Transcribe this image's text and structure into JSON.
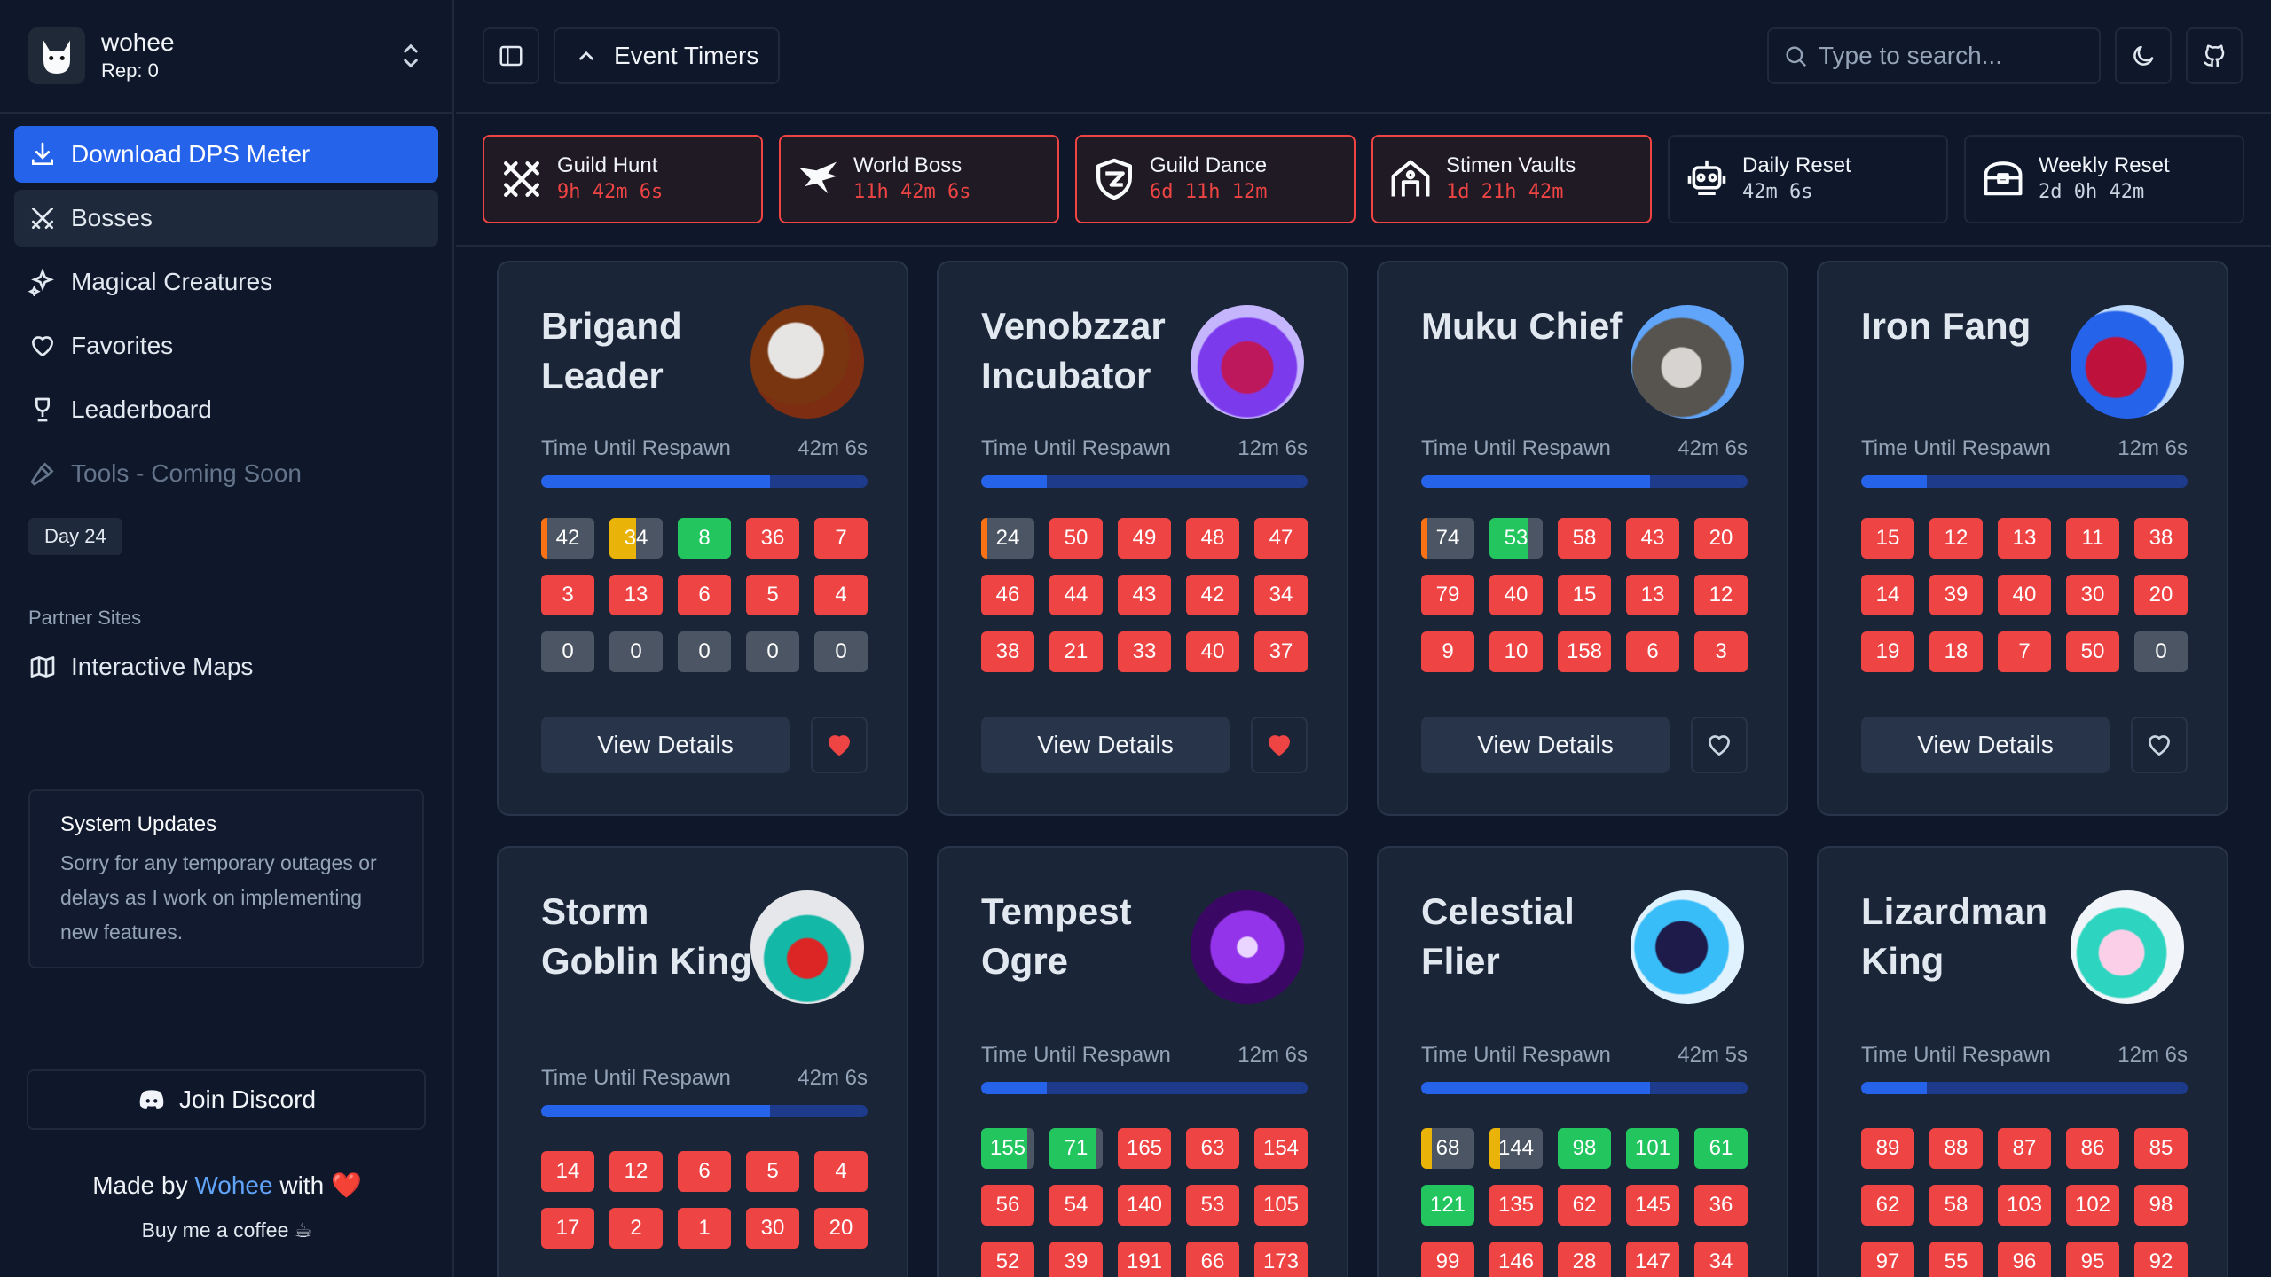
{
  "user": {
    "name": "wohee",
    "rep": "Rep: 0"
  },
  "nav": {
    "download": "Download DPS Meter",
    "bosses": "Bosses",
    "creatures": "Magical Creatures",
    "favorites": "Favorites",
    "leaderboard": "Leaderboard",
    "tools": "Tools - Coming Soon",
    "day": "Day 24",
    "partner_label": "Partner Sites",
    "maps": "Interactive Maps"
  },
  "updates": {
    "title": "System Updates",
    "body": "Sorry for any temporary outages or delays as I work on implementing new features."
  },
  "footer": {
    "discord": "Join Discord",
    "made_prefix": "Made by ",
    "made_name": "Wohee",
    "made_suffix": " with ",
    "heart": "❤️",
    "coffee": "Buy me a coffee ☕"
  },
  "topbar": {
    "event_timers": "Event Timers",
    "search_placeholder": "Type to search..."
  },
  "timers": [
    {
      "name": "Guild Hunt",
      "value": "9h 42m 6s",
      "state": "alert",
      "icon": "crossed-swords-icon"
    },
    {
      "name": "World Boss",
      "value": "11h 42m 6s",
      "state": "alert",
      "icon": "dragon-icon"
    },
    {
      "name": "Guild Dance",
      "value": "6d 11h 12m",
      "state": "alert",
      "icon": "shield-icon"
    },
    {
      "name": "Stimen Vaults",
      "value": "1d 21h 42m",
      "state": "alert",
      "icon": "vault-icon"
    },
    {
      "name": "Daily Reset",
      "value": "42m 6s",
      "state": "normal",
      "icon": "robot-icon"
    },
    {
      "name": "Weekly Reset",
      "value": "2d 0h 42m",
      "state": "normal",
      "icon": "chest-icon"
    }
  ],
  "labels": {
    "respawn": "Time Until Respawn",
    "view_details": "View Details"
  },
  "bosses": [
    {
      "name": "Brigand Leader",
      "respawn": "42m 6s",
      "progress": 0.7,
      "favorite": true,
      "cells": [
        [
          "42",
          "ko"
        ],
        [
          "34",
          "kh"
        ],
        [
          "8",
          "g"
        ],
        [
          "36",
          "r"
        ],
        [
          "7",
          "r"
        ],
        [
          "3",
          "r"
        ],
        [
          "13",
          "r"
        ],
        [
          "6",
          "r"
        ],
        [
          "5",
          "r"
        ],
        [
          "4",
          "r"
        ],
        [
          "0",
          "k"
        ],
        [
          "0",
          "k"
        ],
        [
          "0",
          "k"
        ],
        [
          "0",
          "k"
        ],
        [
          "0",
          "k"
        ]
      ]
    },
    {
      "name": "Venobzzar Incubator",
      "respawn": "12m 6s",
      "progress": 0.2,
      "favorite": true,
      "cells": [
        [
          "24",
          "ko"
        ],
        [
          "50",
          "r"
        ],
        [
          "49",
          "r"
        ],
        [
          "48",
          "r"
        ],
        [
          "47",
          "r"
        ],
        [
          "46",
          "r"
        ],
        [
          "44",
          "r"
        ],
        [
          "43",
          "r"
        ],
        [
          "42",
          "r"
        ],
        [
          "34",
          "r"
        ],
        [
          "38",
          "r"
        ],
        [
          "21",
          "r"
        ],
        [
          "33",
          "r"
        ],
        [
          "40",
          "r"
        ],
        [
          "37",
          "r"
        ]
      ]
    },
    {
      "name": "Muku Chief",
      "respawn": "42m 6s",
      "progress": 0.7,
      "favorite": false,
      "cells": [
        [
          "74",
          "ko"
        ],
        [
          "53",
          "kg"
        ],
        [
          "58",
          "r"
        ],
        [
          "43",
          "r"
        ],
        [
          "20",
          "r"
        ],
        [
          "79",
          "r"
        ],
        [
          "40",
          "r"
        ],
        [
          "15",
          "r"
        ],
        [
          "13",
          "r"
        ],
        [
          "12",
          "r"
        ],
        [
          "9",
          "r"
        ],
        [
          "10",
          "r"
        ],
        [
          "158",
          "r"
        ],
        [
          "6",
          "r"
        ],
        [
          "3",
          "r"
        ]
      ]
    },
    {
      "name": "Iron Fang",
      "respawn": "12m 6s",
      "progress": 0.2,
      "favorite": false,
      "cells": [
        [
          "15",
          "r"
        ],
        [
          "12",
          "r"
        ],
        [
          "13",
          "r"
        ],
        [
          "11",
          "r"
        ],
        [
          "38",
          "r"
        ],
        [
          "14",
          "r"
        ],
        [
          "39",
          "r"
        ],
        [
          "40",
          "r"
        ],
        [
          "30",
          "r"
        ],
        [
          "20",
          "r"
        ],
        [
          "19",
          "r"
        ],
        [
          "18",
          "r"
        ],
        [
          "7",
          "r"
        ],
        [
          "50",
          "r"
        ],
        [
          "0",
          "k"
        ]
      ]
    },
    {
      "name": "Storm Goblin King",
      "respawn": "42m 6s",
      "progress": 0.7,
      "favorite": false,
      "cells": [
        [
          "14",
          "r"
        ],
        [
          "12",
          "r"
        ],
        [
          "6",
          "r"
        ],
        [
          "5",
          "r"
        ],
        [
          "4",
          "r"
        ],
        [
          "17",
          "r"
        ],
        [
          "2",
          "r"
        ],
        [
          "1",
          "r"
        ],
        [
          "30",
          "r"
        ],
        [
          "20",
          "r"
        ]
      ]
    },
    {
      "name": "Tempest Ogre",
      "respawn": "12m 6s",
      "progress": 0.2,
      "favorite": false,
      "cells": [
        [
          "155",
          "kG"
        ],
        [
          "71",
          "kG"
        ],
        [
          "165",
          "r"
        ],
        [
          "63",
          "r"
        ],
        [
          "154",
          "r"
        ],
        [
          "56",
          "r"
        ],
        [
          "54",
          "r"
        ],
        [
          "140",
          "r"
        ],
        [
          "53",
          "r"
        ],
        [
          "105",
          "r"
        ],
        [
          "52",
          "r"
        ],
        [
          "39",
          "r"
        ],
        [
          "191",
          "r"
        ],
        [
          "66",
          "r"
        ],
        [
          "173",
          "r"
        ]
      ]
    },
    {
      "name": "Celestial Flier",
      "respawn": "42m 5s",
      "progress": 0.7,
      "favorite": false,
      "cells": [
        [
          "68",
          "ky"
        ],
        [
          "144",
          "ky"
        ],
        [
          "98",
          "g"
        ],
        [
          "101",
          "g"
        ],
        [
          "61",
          "g"
        ],
        [
          "121",
          "g"
        ],
        [
          "135",
          "r"
        ],
        [
          "62",
          "r"
        ],
        [
          "145",
          "r"
        ],
        [
          "36",
          "r"
        ],
        [
          "99",
          "r"
        ],
        [
          "146",
          "r"
        ],
        [
          "28",
          "r"
        ],
        [
          "147",
          "r"
        ],
        [
          "34",
          "r"
        ]
      ]
    },
    {
      "name": "Lizardman King",
      "respawn": "12m 6s",
      "progress": 0.2,
      "favorite": false,
      "cells": [
        [
          "89",
          "r"
        ],
        [
          "88",
          "r"
        ],
        [
          "87",
          "r"
        ],
        [
          "86",
          "r"
        ],
        [
          "85",
          "r"
        ],
        [
          "62",
          "r"
        ],
        [
          "58",
          "r"
        ],
        [
          "103",
          "r"
        ],
        [
          "102",
          "r"
        ],
        [
          "98",
          "r"
        ],
        [
          "97",
          "r"
        ],
        [
          "55",
          "r"
        ],
        [
          "96",
          "r"
        ],
        [
          "95",
          "r"
        ],
        [
          "92",
          "r"
        ]
      ]
    }
  ],
  "colors": {
    "accent": "#2563eb",
    "alert": "#ef4444",
    "good": "#22c55e",
    "warn": "#eab308"
  }
}
